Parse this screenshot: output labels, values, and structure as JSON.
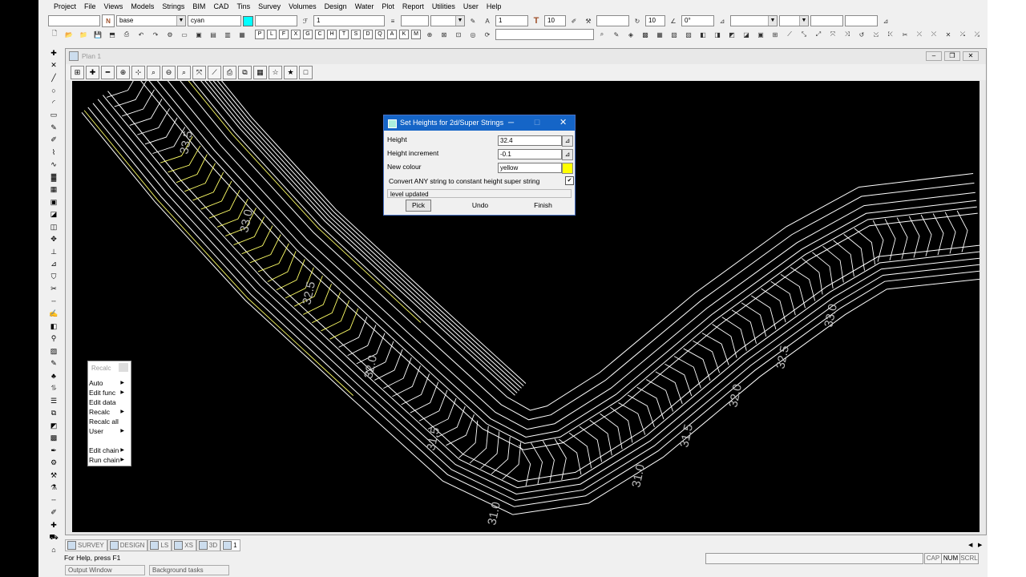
{
  "menubar": [
    "Project",
    "File",
    "Views",
    "Models",
    "Strings",
    "BIM",
    "CAD",
    "Tins",
    "Survey",
    "Volumes",
    "Design",
    "Water",
    "Plot",
    "Report",
    "Utilities",
    "User",
    "Help"
  ],
  "toolbar": {
    "model_value": "base",
    "colour_value": "cyan",
    "colour_swatch": "#00ffff",
    "weight_value": "1",
    "text_size_value": "1",
    "text_height_value": "10",
    "line_count_value": "10",
    "angle_value": "0°",
    "n_label": "N",
    "letters": [
      "P",
      "L",
      "F",
      "X",
      "G",
      "C",
      "H",
      "T",
      "S",
      "D",
      "Q",
      "A",
      "K",
      "M"
    ]
  },
  "plan": {
    "title": "Plan 1"
  },
  "contours": {
    "labels": [
      "33.5",
      "33.0",
      "32.5",
      "32.0",
      "31.5",
      "31.0",
      "33.0",
      "32.5",
      "32.0",
      "31.5",
      "31.0"
    ],
    "main_color": "#ffffff",
    "highlight_color": "#ffff66"
  },
  "dialog": {
    "title": "Set Heights for 2d/Super Strings",
    "height_label": "Height",
    "height_value": "32.4",
    "increment_label": "Height increment",
    "increment_value": "-0.1",
    "colour_label": "New colour",
    "colour_value": "yellow",
    "colour_swatch": "#ffff00",
    "convert_label": "Convert ANY string to constant height super string",
    "convert_checked": "✔",
    "message": "level updated",
    "pick_label": "Pick",
    "undo_label": "Undo",
    "finish_label": "Finish"
  },
  "recalc_menu": {
    "title": "Recalc",
    "items": [
      "Auto",
      "Edit func",
      "Edit data",
      "Recalc",
      "Recalc all",
      "User",
      "Edit chain",
      "Run chain"
    ]
  },
  "bottom_tabs": [
    "SURVEY",
    "DESIGN",
    "LS",
    "XS",
    "3D",
    "1"
  ],
  "status": {
    "help_text": "For Help, press F1",
    "cap": "CAP",
    "num": "NUM",
    "scrl": "SCRL"
  },
  "footer_tabs": [
    "Output Window",
    "Background tasks"
  ]
}
